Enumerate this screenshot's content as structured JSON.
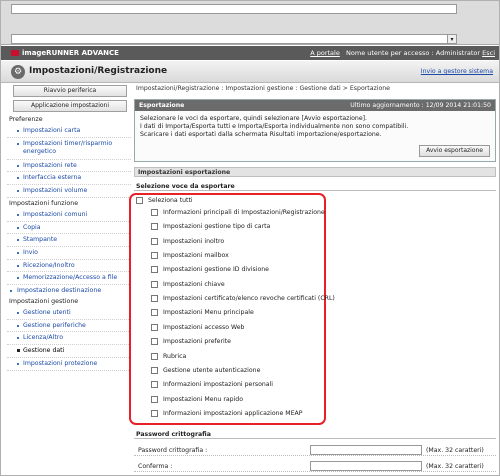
{
  "header": {
    "brand": "imageRUNNER ADVANCE",
    "portal_link": "A portale",
    "user_label": "Nome utente per accesso : Administrator",
    "logout": "Esci"
  },
  "titlebar": {
    "title": "Impostazioni/Registrazione",
    "system_link": "Invio a gestore sistema"
  },
  "sidebar": {
    "buttons": [
      "Riavvio periferica",
      "Applicazione impostazioni"
    ],
    "groups": [
      {
        "title": "Preferenze",
        "items": [
          "Impostazioni carta",
          "Impostazioni timer/risparmio energetico",
          "Impostazioni rete",
          "Interfaccia esterna",
          "Impostazioni volume"
        ]
      },
      {
        "title": "Impostazioni funzione",
        "items": [
          "Impostazioni comuni",
          "Copia",
          "Stampante",
          "Invio",
          "Ricezione/Inoltro",
          "Memorizzazione/Accesso a file"
        ]
      },
      {
        "title": "Impostazione destinazione",
        "items": []
      },
      {
        "title": "Impostazioni gestione",
        "items": [
          "Gestione utenti",
          "Gestione periferiche",
          "Licenza/Altro",
          "Gestione dati",
          "Impostazioni protezione"
        ]
      }
    ]
  },
  "main": {
    "breadcrumb": "Impostazioni/Registrazione : Impostazioni gestione : Gestione dati > Esportazione",
    "panel_title": "Esportazione",
    "last_update": "Ultimo aggiornamento : 12/09 2014 21:01:50",
    "description": [
      "Selezionare le voci da esportare, quindi selezionare [Avvio esportazione].",
      "I dati di Importa/Esporta tutti e Importa/Esporta individualmente non sono compatibili.",
      "Scaricare i dati esportati dalla schermata Risultati importazione/esportazione."
    ],
    "export_button": "Avvio esportazione",
    "export_settings_head": "Impostazioni esportazione",
    "select_head": "Selezione voce da esportare",
    "select_all": "Seleziona tutti",
    "items": [
      "Informazioni principali di Impostazioni/Registrazione",
      "Impostazioni gestione tipo di carta",
      "Impostazioni inoltro",
      "Impostazioni mailbox",
      "Impostazioni gestione ID divisione",
      "Impostazioni chiave",
      "Impostazioni certificato/elenco revoche certificati (CRL)",
      "Impostazioni Menu principale",
      "Impostazioni accesso Web",
      "Impostazioni preferite",
      "Rubrica",
      "Gestione utente autenticazione",
      "Informazioni impostazioni personali",
      "Impostazioni Menu rapido",
      "Informazioni impostazioni applicazione MEAP"
    ],
    "password_head": "Password crittografia",
    "password_label": "Password crittografia :",
    "confirm_label": "Conferma :",
    "max_hint": "(Max. 32 caratteri)"
  }
}
